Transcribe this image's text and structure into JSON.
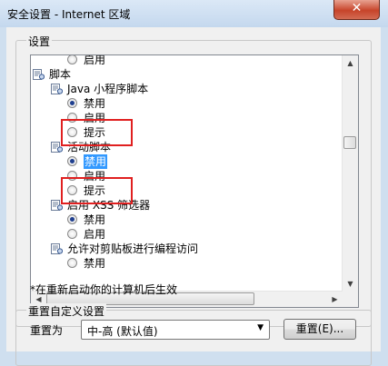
{
  "window": {
    "title": "安全设置 - Internet 区域",
    "close_glyph": "✕"
  },
  "settings_group": {
    "label": "设置"
  },
  "tree": {
    "items": [
      {
        "kind": "radio",
        "label": "启用",
        "checked": false
      },
      {
        "kind": "node",
        "label": "脚本",
        "icon": "settings-icon"
      },
      {
        "kind": "node",
        "label": "Java 小程序脚本",
        "icon": "settings-icon"
      },
      {
        "kind": "radio",
        "label": "禁用",
        "checked": true
      },
      {
        "kind": "radio",
        "label": "启用",
        "checked": false
      },
      {
        "kind": "radio",
        "label": "提示",
        "checked": false
      },
      {
        "kind": "node",
        "label": "活动脚本",
        "icon": "settings-icon"
      },
      {
        "kind": "radio",
        "label": "禁用",
        "checked": true,
        "selected": true
      },
      {
        "kind": "radio",
        "label": "启用",
        "checked": false
      },
      {
        "kind": "radio",
        "label": "提示",
        "checked": false
      },
      {
        "kind": "node",
        "label": "启用 XSS 筛选器",
        "icon": "settings-icon"
      },
      {
        "kind": "radio",
        "label": "禁用",
        "checked": true
      },
      {
        "kind": "radio",
        "label": "启用",
        "checked": false
      },
      {
        "kind": "node",
        "label": "允许对剪贴板进行编程访问",
        "icon": "settings-icon"
      },
      {
        "kind": "radio",
        "label": "禁用",
        "checked": false
      }
    ]
  },
  "note": "*在重新启动你的计算机后生效",
  "reset_group": {
    "label": "重置自定义设置",
    "reset_to_label": "重置为",
    "dropdown_value": "中-高 (默认值)",
    "reset_button": "重置(E)..."
  },
  "colors": {
    "highlight_box": "#e02020",
    "selection": "#3399ff"
  }
}
